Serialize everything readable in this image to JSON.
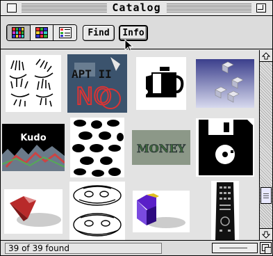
{
  "window": {
    "title": "Catalog"
  },
  "toolbar": {
    "view_modes": [
      "large-thumbnails",
      "small-thumbnails",
      "list"
    ],
    "active_view": "large-thumbnails",
    "find_label": "Find",
    "info_label": "Info"
  },
  "thumbnails": [
    {
      "name": "hands-drawing"
    },
    {
      "name": "apt-11-no-collage",
      "text": "APT II NO"
    },
    {
      "name": "mug-icon"
    },
    {
      "name": "floating-cubes-render"
    },
    {
      "name": "kudo-banner",
      "text": "Kudo"
    },
    {
      "name": "leaf-silhouettes"
    },
    {
      "name": "money-texture",
      "text": "MONEY"
    },
    {
      "name": "floppy-disk-icon"
    },
    {
      "name": "red-shape-render"
    },
    {
      "name": "skull-sketches"
    },
    {
      "name": "purple-3d-shape"
    },
    {
      "name": "remote-control"
    }
  ],
  "status": {
    "found_text": "39 of 39 found"
  },
  "colors": {
    "window_bg": "#dcdcdc",
    "content_bg": "#e3e3e3",
    "scroll_thumb": "#e9e9ff"
  }
}
